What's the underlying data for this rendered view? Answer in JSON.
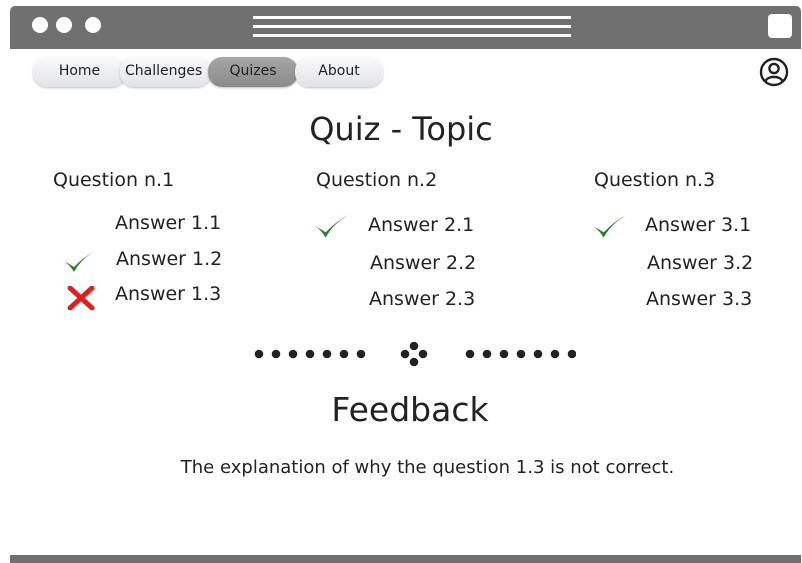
{
  "nav": {
    "tabs": [
      {
        "label": "Home"
      },
      {
        "label": "Challenges"
      },
      {
        "label": "Quizes",
        "active": true
      },
      {
        "label": "About"
      }
    ]
  },
  "main": {
    "title": "Quiz - Topic",
    "questions": [
      {
        "label": "Question n.1",
        "answers": [
          {
            "label": "Answer 1.1",
            "mark": "none"
          },
          {
            "label": "Answer 1.2",
            "mark": "check"
          },
          {
            "label": "Answer 1.3",
            "mark": "cross"
          }
        ]
      },
      {
        "label": "Question n.2",
        "answers": [
          {
            "label": "Answer 2.1",
            "mark": "check"
          },
          {
            "label": "Answer 2.2",
            "mark": "none"
          },
          {
            "label": "Answer 2.3",
            "mark": "none"
          }
        ]
      },
      {
        "label": "Question n.3",
        "answers": [
          {
            "label": "Answer 3.1",
            "mark": "check"
          },
          {
            "label": "Answer 3.2",
            "mark": "none"
          },
          {
            "label": "Answer 3.3",
            "mark": "none"
          }
        ]
      }
    ],
    "feedback": {
      "title": "Feedback",
      "text": "The explanation of why the question 1.3 is not correct."
    }
  },
  "colors": {
    "chrome": "#707070",
    "check": "#2e7d32",
    "cross": "#e02020",
    "active_tab": "#999999"
  },
  "icons": {
    "window_controls": "three-dots-icon",
    "menu": "hamburger-icon",
    "window_button": "square-icon",
    "avatar": "user-circle-icon",
    "correct": "check-icon",
    "wrong": "cross-icon",
    "divider": "ornament-divider-icon"
  }
}
